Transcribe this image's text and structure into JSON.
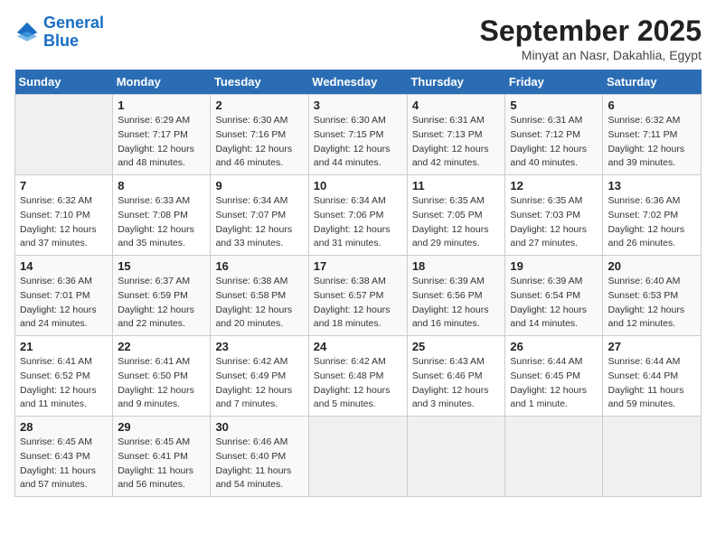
{
  "header": {
    "logo_line1": "General",
    "logo_line2": "Blue",
    "month_title": "September 2025",
    "subtitle": "Minyat an Nasr, Dakahlia, Egypt"
  },
  "weekdays": [
    "Sunday",
    "Monday",
    "Tuesday",
    "Wednesday",
    "Thursday",
    "Friday",
    "Saturday"
  ],
  "weeks": [
    [
      {
        "day": "",
        "info": ""
      },
      {
        "day": "1",
        "info": "Sunrise: 6:29 AM\nSunset: 7:17 PM\nDaylight: 12 hours\nand 48 minutes."
      },
      {
        "day": "2",
        "info": "Sunrise: 6:30 AM\nSunset: 7:16 PM\nDaylight: 12 hours\nand 46 minutes."
      },
      {
        "day": "3",
        "info": "Sunrise: 6:30 AM\nSunset: 7:15 PM\nDaylight: 12 hours\nand 44 minutes."
      },
      {
        "day": "4",
        "info": "Sunrise: 6:31 AM\nSunset: 7:13 PM\nDaylight: 12 hours\nand 42 minutes."
      },
      {
        "day": "5",
        "info": "Sunrise: 6:31 AM\nSunset: 7:12 PM\nDaylight: 12 hours\nand 40 minutes."
      },
      {
        "day": "6",
        "info": "Sunrise: 6:32 AM\nSunset: 7:11 PM\nDaylight: 12 hours\nand 39 minutes."
      }
    ],
    [
      {
        "day": "7",
        "info": "Sunrise: 6:32 AM\nSunset: 7:10 PM\nDaylight: 12 hours\nand 37 minutes."
      },
      {
        "day": "8",
        "info": "Sunrise: 6:33 AM\nSunset: 7:08 PM\nDaylight: 12 hours\nand 35 minutes."
      },
      {
        "day": "9",
        "info": "Sunrise: 6:34 AM\nSunset: 7:07 PM\nDaylight: 12 hours\nand 33 minutes."
      },
      {
        "day": "10",
        "info": "Sunrise: 6:34 AM\nSunset: 7:06 PM\nDaylight: 12 hours\nand 31 minutes."
      },
      {
        "day": "11",
        "info": "Sunrise: 6:35 AM\nSunset: 7:05 PM\nDaylight: 12 hours\nand 29 minutes."
      },
      {
        "day": "12",
        "info": "Sunrise: 6:35 AM\nSunset: 7:03 PM\nDaylight: 12 hours\nand 27 minutes."
      },
      {
        "day": "13",
        "info": "Sunrise: 6:36 AM\nSunset: 7:02 PM\nDaylight: 12 hours\nand 26 minutes."
      }
    ],
    [
      {
        "day": "14",
        "info": "Sunrise: 6:36 AM\nSunset: 7:01 PM\nDaylight: 12 hours\nand 24 minutes."
      },
      {
        "day": "15",
        "info": "Sunrise: 6:37 AM\nSunset: 6:59 PM\nDaylight: 12 hours\nand 22 minutes."
      },
      {
        "day": "16",
        "info": "Sunrise: 6:38 AM\nSunset: 6:58 PM\nDaylight: 12 hours\nand 20 minutes."
      },
      {
        "day": "17",
        "info": "Sunrise: 6:38 AM\nSunset: 6:57 PM\nDaylight: 12 hours\nand 18 minutes."
      },
      {
        "day": "18",
        "info": "Sunrise: 6:39 AM\nSunset: 6:56 PM\nDaylight: 12 hours\nand 16 minutes."
      },
      {
        "day": "19",
        "info": "Sunrise: 6:39 AM\nSunset: 6:54 PM\nDaylight: 12 hours\nand 14 minutes."
      },
      {
        "day": "20",
        "info": "Sunrise: 6:40 AM\nSunset: 6:53 PM\nDaylight: 12 hours\nand 12 minutes."
      }
    ],
    [
      {
        "day": "21",
        "info": "Sunrise: 6:41 AM\nSunset: 6:52 PM\nDaylight: 12 hours\nand 11 minutes."
      },
      {
        "day": "22",
        "info": "Sunrise: 6:41 AM\nSunset: 6:50 PM\nDaylight: 12 hours\nand 9 minutes."
      },
      {
        "day": "23",
        "info": "Sunrise: 6:42 AM\nSunset: 6:49 PM\nDaylight: 12 hours\nand 7 minutes."
      },
      {
        "day": "24",
        "info": "Sunrise: 6:42 AM\nSunset: 6:48 PM\nDaylight: 12 hours\nand 5 minutes."
      },
      {
        "day": "25",
        "info": "Sunrise: 6:43 AM\nSunset: 6:46 PM\nDaylight: 12 hours\nand 3 minutes."
      },
      {
        "day": "26",
        "info": "Sunrise: 6:44 AM\nSunset: 6:45 PM\nDaylight: 12 hours\nand 1 minute."
      },
      {
        "day": "27",
        "info": "Sunrise: 6:44 AM\nSunset: 6:44 PM\nDaylight: 11 hours\nand 59 minutes."
      }
    ],
    [
      {
        "day": "28",
        "info": "Sunrise: 6:45 AM\nSunset: 6:43 PM\nDaylight: 11 hours\nand 57 minutes."
      },
      {
        "day": "29",
        "info": "Sunrise: 6:45 AM\nSunset: 6:41 PM\nDaylight: 11 hours\nand 56 minutes."
      },
      {
        "day": "30",
        "info": "Sunrise: 6:46 AM\nSunset: 6:40 PM\nDaylight: 11 hours\nand 54 minutes."
      },
      {
        "day": "",
        "info": ""
      },
      {
        "day": "",
        "info": ""
      },
      {
        "day": "",
        "info": ""
      },
      {
        "day": "",
        "info": ""
      }
    ]
  ]
}
